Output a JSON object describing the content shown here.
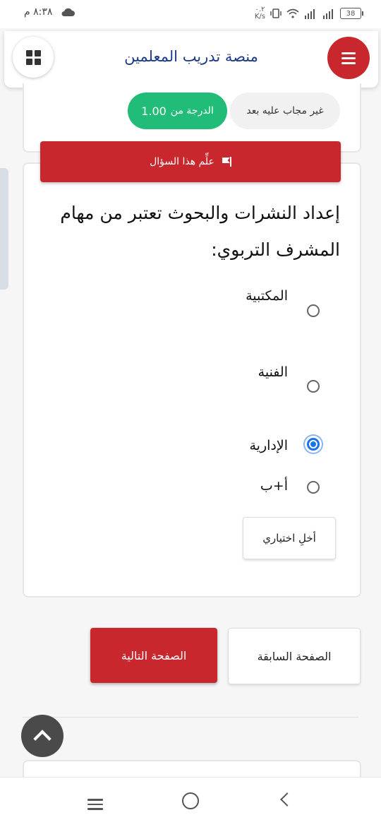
{
  "status_bar": {
    "time": "٨:٣٨ م",
    "net_speed_top": "٠.٢",
    "net_speed_unit": "K/s",
    "battery": "38"
  },
  "header": {
    "title": "منصة تدريب المعلمين"
  },
  "question_info": {
    "state": "غير مجاب عليه بعد",
    "grade_label": "الدرجة من",
    "grade_value": "1.00",
    "flag_label": "علِّم هذا السؤال"
  },
  "question": {
    "text": "إعداد النشرات والبحوث تعتبر من مهام المشرف التربوي:",
    "options": [
      {
        "label": "المكتبية",
        "selected": false
      },
      {
        "label": "الفنية",
        "selected": false
      },
      {
        "label": "الإدارية",
        "selected": true
      },
      {
        "label": "أ+ب",
        "selected": false
      }
    ],
    "clear_label": "أخلِ اختياري"
  },
  "navigation": {
    "previous_label": "الصفحة السابقة",
    "next_label": "الصفحة التالية"
  },
  "colors": {
    "brand_red": "#c8272d",
    "grade_green": "#21bd78",
    "title_blue": "#1d3a8a",
    "radio_blue": "#1a73e8"
  }
}
